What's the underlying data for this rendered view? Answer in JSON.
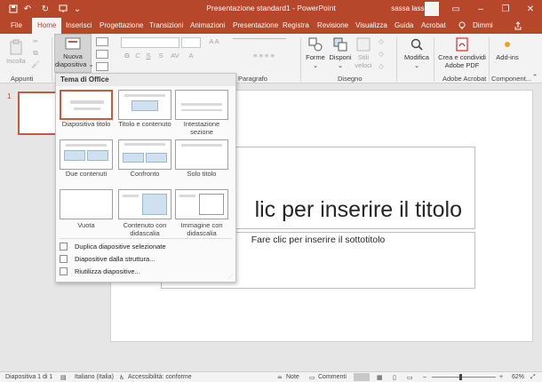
{
  "app": {
    "doc_title": "Presentazione standard1  -  PowerPoint",
    "user_name": "sassa lassa",
    "accent": "#b7472a"
  },
  "quick_access": [
    "save-icon",
    "undo-icon",
    "redo-icon",
    "start-slideshow-icon",
    "customize-icon"
  ],
  "tabs": [
    {
      "label": "File"
    },
    {
      "label": "Home"
    },
    {
      "label": "Inserisci"
    },
    {
      "label": "Progettazione"
    },
    {
      "label": "Transizioni"
    },
    {
      "label": "Animazioni"
    },
    {
      "label": "Presentazione"
    },
    {
      "label": "Registra"
    },
    {
      "label": "Revisione"
    },
    {
      "label": "Visualizza"
    },
    {
      "label": "Guida"
    },
    {
      "label": "Acrobat"
    },
    {
      "label": "Dimmi"
    }
  ],
  "active_tab": "Home",
  "ribbon": {
    "paste_label": "Incolla",
    "new_slide_label_1": "Nuova",
    "new_slide_label_2": "diapositiva",
    "shapes_label": "Forme",
    "arrange_label": "Disponi",
    "quick_styles_1": "Stili",
    "quick_styles_2": "veloci",
    "edit_label": "Modifica",
    "pdf_label_1": "Crea e condividi",
    "pdf_label_2": "Adobe PDF",
    "addins_label": "Add-ins",
    "groups": {
      "clipboard": "Appunti",
      "paragraph": "Paragrafo",
      "drawing": "Disegno",
      "acrobat": "Adobe Acrobat",
      "components": "Component..."
    }
  },
  "dropdown": {
    "header": "Tema di Office",
    "layouts": [
      {
        "label": "Diapositiva titolo"
      },
      {
        "label": "Titolo e contenuto"
      },
      {
        "label": "Intestazione sezione"
      },
      {
        "label": "Due contenuti"
      },
      {
        "label": "Confronto"
      },
      {
        "label": "Solo titolo"
      },
      {
        "label": "Vuota"
      },
      {
        "label": "Contenuto con didascalia"
      },
      {
        "label": "Immagine con didascalia"
      }
    ],
    "actions": [
      {
        "label": "Duplica diapositive selezionate"
      },
      {
        "label": "Diapositive dalla struttura..."
      },
      {
        "label": "Riutilizza diapositive..."
      }
    ]
  },
  "slide_panel": {
    "number": "1"
  },
  "slide": {
    "title_placeholder": "lic per inserire il titolo",
    "subtitle_placeholder": "Fare clic per inserire il sottotitolo"
  },
  "status": {
    "slide_counter": "Diapositiva 1 di 1",
    "language": "Italiano (Italia)",
    "accessibility": "Accessibilità: conforme",
    "notes": "Note",
    "comments": "Commenti",
    "zoom": "62%"
  }
}
